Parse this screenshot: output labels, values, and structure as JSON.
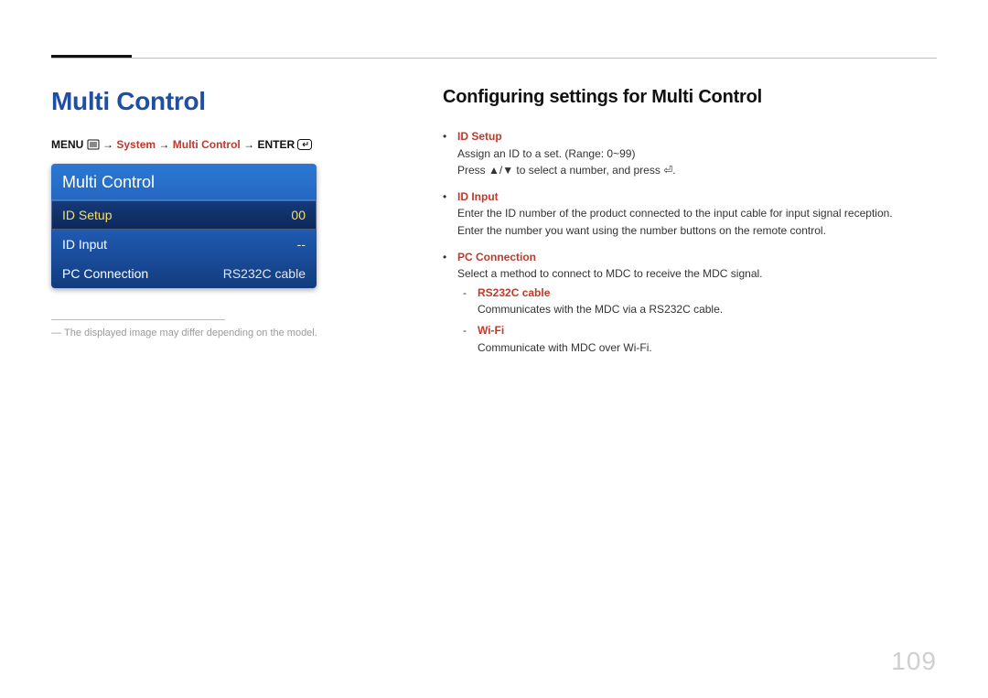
{
  "page_number": "109",
  "main_heading": "Multi Control",
  "section_heading": "Configuring settings for Multi Control",
  "breadcrumb": {
    "menu": "MENU",
    "arrow": "→",
    "system": "System",
    "multi_control": "Multi Control",
    "enter": "ENTER"
  },
  "osd": {
    "title": "Multi Control",
    "rows": [
      {
        "label": "ID Setup",
        "value": "00",
        "selected": true
      },
      {
        "label": "ID Input",
        "value": "--",
        "selected": false
      },
      {
        "label": "PC Connection",
        "value": "RS232C cable",
        "selected": false
      }
    ]
  },
  "footnote": {
    "dash": "―",
    "text": "The displayed image may differ depending on the model."
  },
  "features": {
    "dot": "•",
    "dash": "-",
    "items": [
      {
        "label": "ID Setup",
        "body_lines": [
          "Assign an ID to a set. (Range: 0~99)",
          "Press ▲/▼ to select a number, and press ⏎."
        ]
      },
      {
        "label": "ID Input",
        "body_lines": [
          "Enter the ID number of the product connected to the input cable for input signal reception.",
          "Enter the number you want using the number buttons on the remote control."
        ]
      },
      {
        "label": "PC Connection",
        "body_lines": [
          "Select a method to connect to MDC to receive the MDC signal."
        ],
        "sub": [
          {
            "label": "RS232C cable",
            "body": "Communicates with the MDC via a RS232C cable."
          },
          {
            "label": "Wi-Fi",
            "body": "Communicate with MDC over Wi-Fi."
          }
        ]
      }
    ]
  }
}
